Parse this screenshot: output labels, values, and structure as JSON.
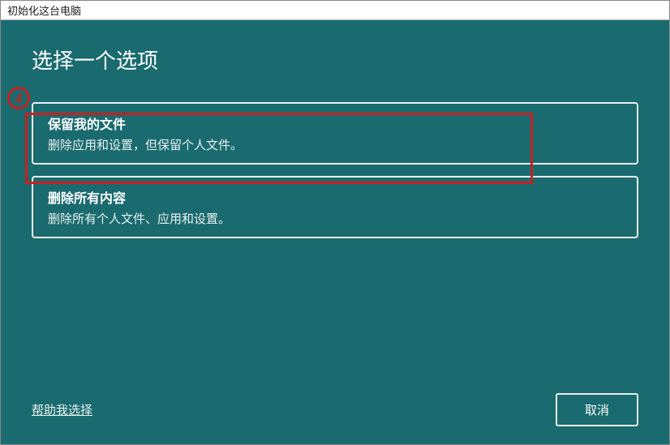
{
  "window": {
    "title": "初始化这台电脑"
  },
  "heading": "选择一个选项",
  "annotation": {
    "number": "4"
  },
  "options": [
    {
      "title": "保留我的文件",
      "description": "删除应用和设置，但保留个人文件。"
    },
    {
      "title": "删除所有内容",
      "description": "删除所有个人文件、应用和设置。"
    }
  ],
  "footer": {
    "help_link": "帮助我选择",
    "cancel_label": "取消"
  }
}
